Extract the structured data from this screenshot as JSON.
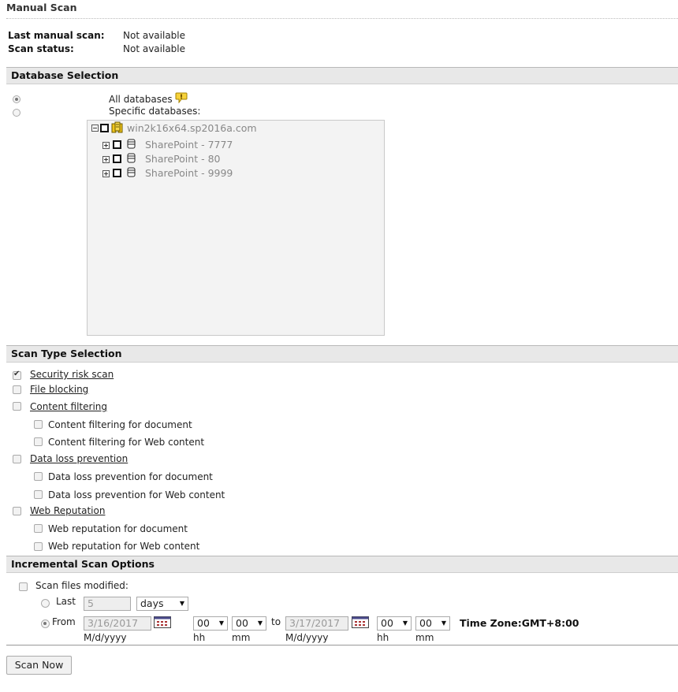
{
  "page_title": "Manual Scan",
  "info": {
    "last_manual_scan_label": "Last manual scan:",
    "last_manual_scan_value": "Not available",
    "scan_status_label": "Scan status:",
    "scan_status_value": "Not available"
  },
  "database_selection": {
    "header": "Database Selection",
    "all_databases_label": "All databases",
    "specific_databases_label": "Specific databases:",
    "selected": "all",
    "tree": {
      "root": "win2k16x64.sp2016a.com",
      "children": [
        "SharePoint - 7777",
        "SharePoint - 80",
        "SharePoint - 9999"
      ]
    }
  },
  "scan_type_selection": {
    "header": "Scan Type Selection",
    "security_risk_scan": "Security risk scan",
    "file_blocking": "File blocking",
    "content_filtering": "Content filtering",
    "content_filtering_document": "Content filtering for document",
    "content_filtering_web": "Content filtering for Web content",
    "data_loss_prevention": "Data loss prevention",
    "dlp_document": "Data loss prevention for document",
    "dlp_web": "Data loss prevention for Web content",
    "web_reputation": "Web Reputation",
    "web_reputation_document": "Web reputation for document",
    "web_reputation_web": "Web reputation for Web content"
  },
  "incremental_scan": {
    "header": "Incremental Scan Options",
    "scan_files_modified_label": "Scan files modified:",
    "last_label": "Last",
    "last_value": "5",
    "last_unit": "days",
    "from_label": "From",
    "from_date": "3/16/2017",
    "from_hh": "00",
    "from_mm": "00",
    "to_label": "to",
    "to_date": "3/17/2017",
    "to_hh": "00",
    "to_mm": "00",
    "timezone": "Time Zone:GMT+8:00",
    "date_format_label": "M/d/yyyy",
    "hh_label": "hh",
    "mm_label": "mm"
  },
  "scan_now_button": "Scan Now"
}
